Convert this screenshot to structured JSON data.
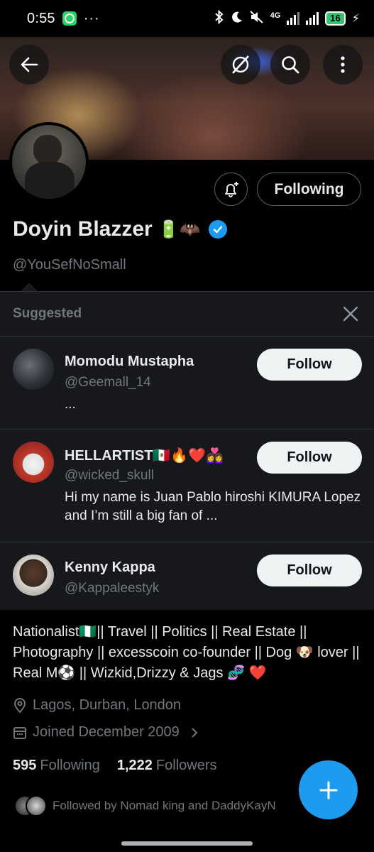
{
  "status_bar": {
    "time": "0:55",
    "more": "···",
    "network": "4G",
    "battery": "16"
  },
  "header": {
    "icons": [
      "back-arrow-icon",
      "grok-icon",
      "search-icon",
      "more-vertical-icon"
    ]
  },
  "profile": {
    "name": "Doyin Blazzer",
    "name_emojis": "🔋🦇",
    "handle": "@YouSefNoSmall",
    "following_button": "Following",
    "bio": "Nationalist🇳🇬|| Travel || Politics || Real Estate || Photography || excesscoin co-founder || Dog 🐶 lover || Real M⚽ || Wizkid,Drizzy & Jags 🧬 ❤️",
    "location": "Lagos, Durban, London",
    "joined": "Joined December 2009",
    "following_count": "595",
    "following_label": "Following",
    "followers_count": "1,222",
    "followers_label": "Followers",
    "followed_by": "Followed by Nomad king and DaddyKayN"
  },
  "suggested": {
    "title": "Suggested",
    "items": [
      {
        "name": "Momodu Mustapha",
        "handle": "@Geemall_14",
        "bio": "...",
        "button": "Follow"
      },
      {
        "name": "HELLARTIST🇲🇽🔥❤️👩‍❤️‍👩",
        "handle": "@wicked_skull",
        "bio": "Hi my name is Juan Pablo hiroshi KIMURA Lopez and I’m still a big fan of ...",
        "button": "Follow"
      },
      {
        "name": "Kenny Kappa",
        "handle": "@Kappaleestyk",
        "bio": "",
        "button": "Follow"
      }
    ]
  },
  "colors": {
    "accent": "#1d9bf0",
    "background": "#000000",
    "panel": "#16181c",
    "muted_text": "#71767b"
  }
}
